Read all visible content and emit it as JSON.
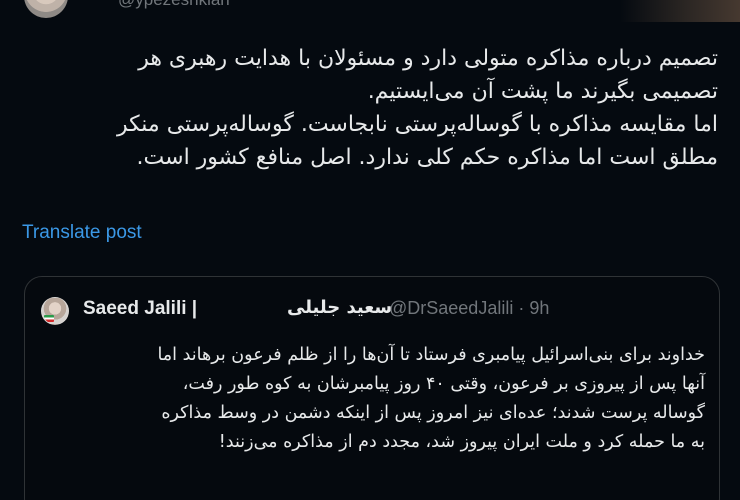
{
  "header": {
    "handle": "@ypezeshkian"
  },
  "tweet": {
    "lines": [
      "تصمیم درباره مذاکره متولی دارد و مسئولان با هدایت رهبری هر",
      "تصمیمی بگیرند ما پشت آن می‌ایستیم.",
      "اما مقایسه مذاکره با گوساله‌پرستی نابجاست. گوساله‌پرستی منکر",
      "مطلق است اما مذاکره حکم کلی ندارد. اصل منافع کشور است."
    ],
    "translate_label": "Translate post"
  },
  "quote": {
    "name": "Saeed Jalili |",
    "name_fa": "سعید جلیلی",
    "handle_time": "@DrSaeedJalili · 9h",
    "lines": [
      "خداوند برای بنی‌اسرائیل پیامبری فرستاد تا آن‌ها را از ظلم فرعون برهاند اما",
      "آنها پس از پیروزی بر فرعون، وقتی ۴۰ روز پیامبرشان به کوه طور رفت،",
      "گوساله پرست شدند؛ عده‌ای نیز امروز پس از اینکه دشمن در وسط مذاکره",
      "به ما حمله کرد و ملت ایران پیروز شد، مجدد دم از مذاکره می‌زنند!"
    ]
  },
  "colors": {
    "background": "#050a10",
    "text": "#e7e9ea",
    "muted": "#71767b",
    "link": "#3b98e6",
    "border": "#2f3336"
  }
}
